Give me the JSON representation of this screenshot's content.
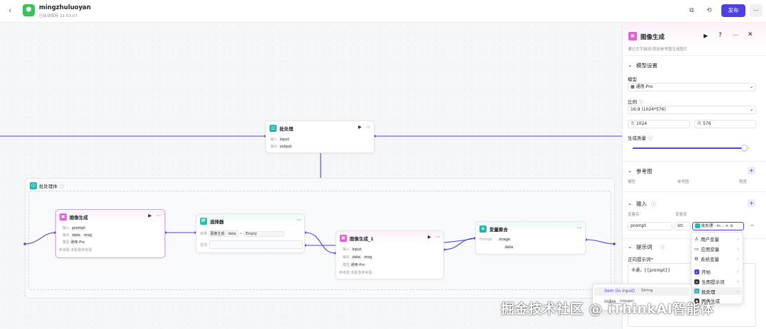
{
  "header": {
    "project_name": "mingzhuluoyan",
    "save_status": "已自动保存 11:03:07",
    "publish_label": "发布"
  },
  "nodes": {
    "batch_top": {
      "title": "批处理",
      "input_label": "输入",
      "input_tag": "input",
      "output_label": "输出",
      "output_tag": "output"
    },
    "group": {
      "title": "批处理体"
    },
    "image_gen": {
      "title": "图像生成",
      "input_label": "输入",
      "input_tag": "prompt",
      "output_label": "输出",
      "out1": "data",
      "out2": "msg",
      "model_label": "模型",
      "model": "通用-Pro",
      "ref_label": "参考图",
      "ref_value": "未配置参考图"
    },
    "selector": {
      "title": "选择器",
      "cond_label": "如果",
      "cond_src": "图像生成",
      "cond_var": "data",
      "cond_op": "=",
      "cond_val": "Empty",
      "else_label": "否则"
    },
    "image_gen1": {
      "title": "图像生成_1",
      "input_label": "输入",
      "input_tag": "input",
      "output_label": "输出",
      "out1": "data",
      "out2": "msg",
      "model_label": "模型",
      "model": "通用-Pro",
      "ref_label": "参考图",
      "ref_value": "未配置参考图"
    },
    "aggregate": {
      "title": "变量聚合",
      "row_label": "Prompt",
      "tag1": "image",
      "tag2": "data"
    }
  },
  "panel": {
    "title": "图像生成",
    "desc": "通过文字描述/添加参考图生成图片",
    "model_section": "模型设置",
    "model_label": "模型",
    "model_value": "通用-Pro",
    "ratio_label": "比例",
    "ratio_value": "16:9 (1024*576)",
    "width_label": "宽",
    "width_value": "1024",
    "height_label": "高",
    "height_value": "576",
    "quality_label": "生成质量",
    "quality_level": 0.95,
    "ref_section": "参考图",
    "ref_col1": "模型",
    "ref_col2": "参考图",
    "ref_col3": "程度",
    "input_section": "输入",
    "var_name_col": "变量名",
    "var_value_col": "变量值",
    "var_name": "prompt",
    "var_type": "str.",
    "var_ref": "批处理 - in...",
    "prompt_section": "提示词",
    "positive_label": "正向提示词*",
    "prompt_text": "卡通，{{prompt}}"
  },
  "menu": {
    "items": [
      {
        "label": "用户变量"
      },
      {
        "label": "应用变量"
      },
      {
        "label": "系统变量"
      },
      {
        "label": "开始"
      },
      {
        "label": "生图提示词"
      },
      {
        "label": "批处理"
      },
      {
        "label": "图像生成"
      }
    ]
  },
  "submenu": {
    "item_name": "item (in input)",
    "item_type": "String",
    "index_name": "index",
    "index_type": "Integer"
  },
  "watermark": "掘金技术社区 @ iThinkAI智能体",
  "colors": {
    "accent": "#4e40e5",
    "image_node": "#e85bd8",
    "batch_node": "#1fb8b0",
    "selector_node": "#26c0b0",
    "wire": "#4e40e5"
  }
}
